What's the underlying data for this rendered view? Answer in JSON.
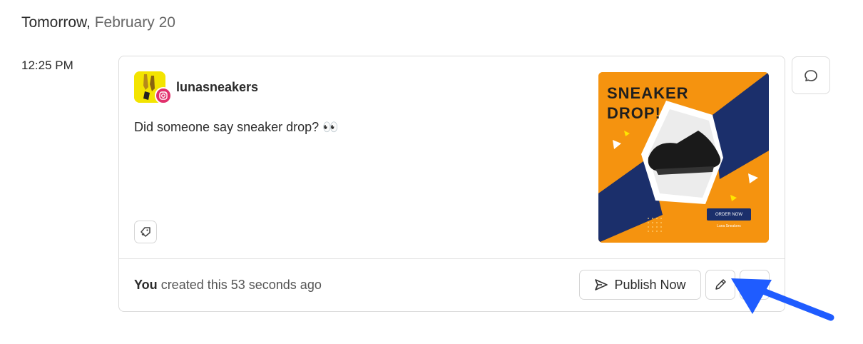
{
  "day_heading": {
    "day": "Tomorrow,",
    "date": "February 20"
  },
  "slot": {
    "time": "12:25 PM"
  },
  "post": {
    "account_name": "lunasneakers",
    "network_icon": "instagram-icon",
    "text": "Did someone say sneaker drop? 👀",
    "media": {
      "headline": "SNEAKER\nDROP!",
      "cta": "ORDER NOW",
      "brand": "Luna Sneakers",
      "colors": {
        "background": "#f5930f",
        "accent": "#1b2f6b"
      }
    },
    "footer": {
      "who": "You",
      "created": "created this 53 seconds ago"
    },
    "actions": {
      "publish_label": "Publish Now",
      "edit_icon": "pencil-icon",
      "tag_icon": "tag-icon",
      "comment_icon": "comment-icon"
    }
  },
  "annotation": {
    "color": "#1f5cff"
  }
}
